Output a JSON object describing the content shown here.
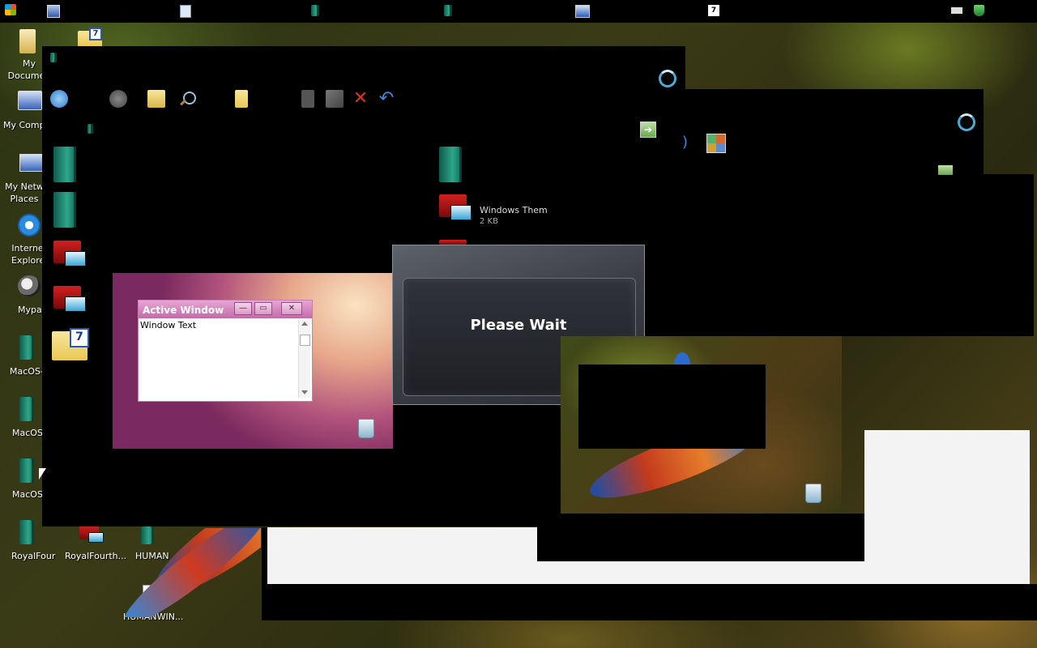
{
  "taskbar": {
    "icons": [
      "windows-logo-icon",
      "computer-icon",
      "document-icon",
      "book-icon",
      "book-icon",
      "monitor-icon",
      "seven-folder-icon"
    ],
    "tray": [
      "keyboard-icon",
      "network-shield-icon"
    ]
  },
  "desktop": {
    "icons": [
      {
        "label": "My\nDocumen",
        "icon": "documents-icon"
      },
      {
        "label": "My Compu",
        "icon": "computer-icon"
      },
      {
        "label": "My Netw\nPlaces",
        "icon": "network-icon"
      },
      {
        "label": "Interne\nExplore",
        "icon": "ie-icon"
      },
      {
        "label": "Mypal",
        "icon": "mypal-icon"
      },
      {
        "label": "MacOS-",
        "icon": "book-icon"
      },
      {
        "label": "MacOS-",
        "icon": "book-icon"
      },
      {
        "label": "MacOS-",
        "icon": "book-icon"
      },
      {
        "label": "RoyalFour",
        "icon": "book-icon"
      },
      {
        "label": "RoyalFourth...",
        "icon": "monitor-icon"
      },
      {
        "label": "HUMAN",
        "icon": "book-icon"
      },
      {
        "label": "HUMANWIN...",
        "icon": "windows-file-icon"
      }
    ]
  },
  "explorer": {
    "file_name": "Windows Them",
    "file_size": "2 KB"
  },
  "active_window": {
    "title": "Active Window",
    "body_text": "Window Text",
    "min_glyph": "—",
    "max_glyph": "▭",
    "close_glyph": "✕"
  },
  "dialog": {
    "text": "Please Wait"
  },
  "colors": {
    "active_title": "#c36aa8",
    "spinner": "#4aaad8",
    "dialog_bg": "#3a3d44"
  }
}
